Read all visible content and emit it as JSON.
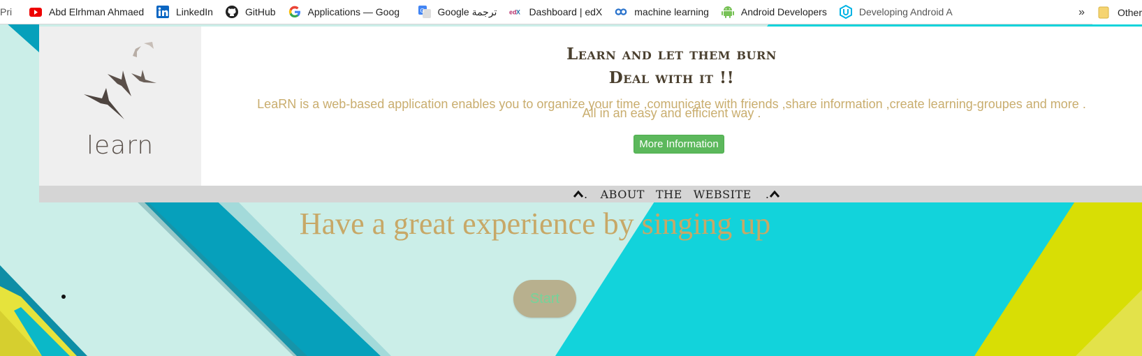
{
  "bookmarks": {
    "items": [
      {
        "label": "Pri",
        "icon": "document-icon"
      },
      {
        "label": "Abd Elrhman Ahmaed",
        "icon": "youtube-icon"
      },
      {
        "label": "LinkedIn",
        "icon": "linkedin-icon"
      },
      {
        "label": "GitHub",
        "icon": "github-icon"
      },
      {
        "label": "Applications — Goog",
        "icon": "google-icon"
      },
      {
        "label": "Google ترجمة",
        "icon": "google-translate-icon"
      },
      {
        "label": "Dashboard | edX",
        "icon": "edx-icon"
      },
      {
        "label": "machine learning",
        "icon": "coursera-icon"
      },
      {
        "label": "Android Developers",
        "icon": "android-icon"
      },
      {
        "label": "Developing Android A",
        "icon": "udacity-icon"
      }
    ],
    "more": "»",
    "other_label": "Other",
    "other_icon": "folder-icon"
  },
  "header": {
    "logo_text": "learn",
    "title_line1": "Learn and let them burn",
    "title_line2": "Deal with it !!",
    "description": "LeaRN is a web-based application enables you to organize your time ,comunicate with friends ,share information ,create learning-groupes and more .",
    "description2": "All in an easy and efficient way .",
    "more_button": "More Information"
  },
  "about": {
    "dot1": ".",
    "word1": "ABOUT",
    "word2": "THE",
    "word3": "WEBSITE",
    "dot2": "."
  },
  "hero": {
    "text": "Have a great experience by singing up",
    "start_button": "Start"
  },
  "colors": {
    "title": "#4a3f2e",
    "description": "#c9ad6e",
    "hero": "#c7a867",
    "button_green": "#5cb85c",
    "start_bg": "#b8b08e",
    "start_text": "#74d49a"
  }
}
